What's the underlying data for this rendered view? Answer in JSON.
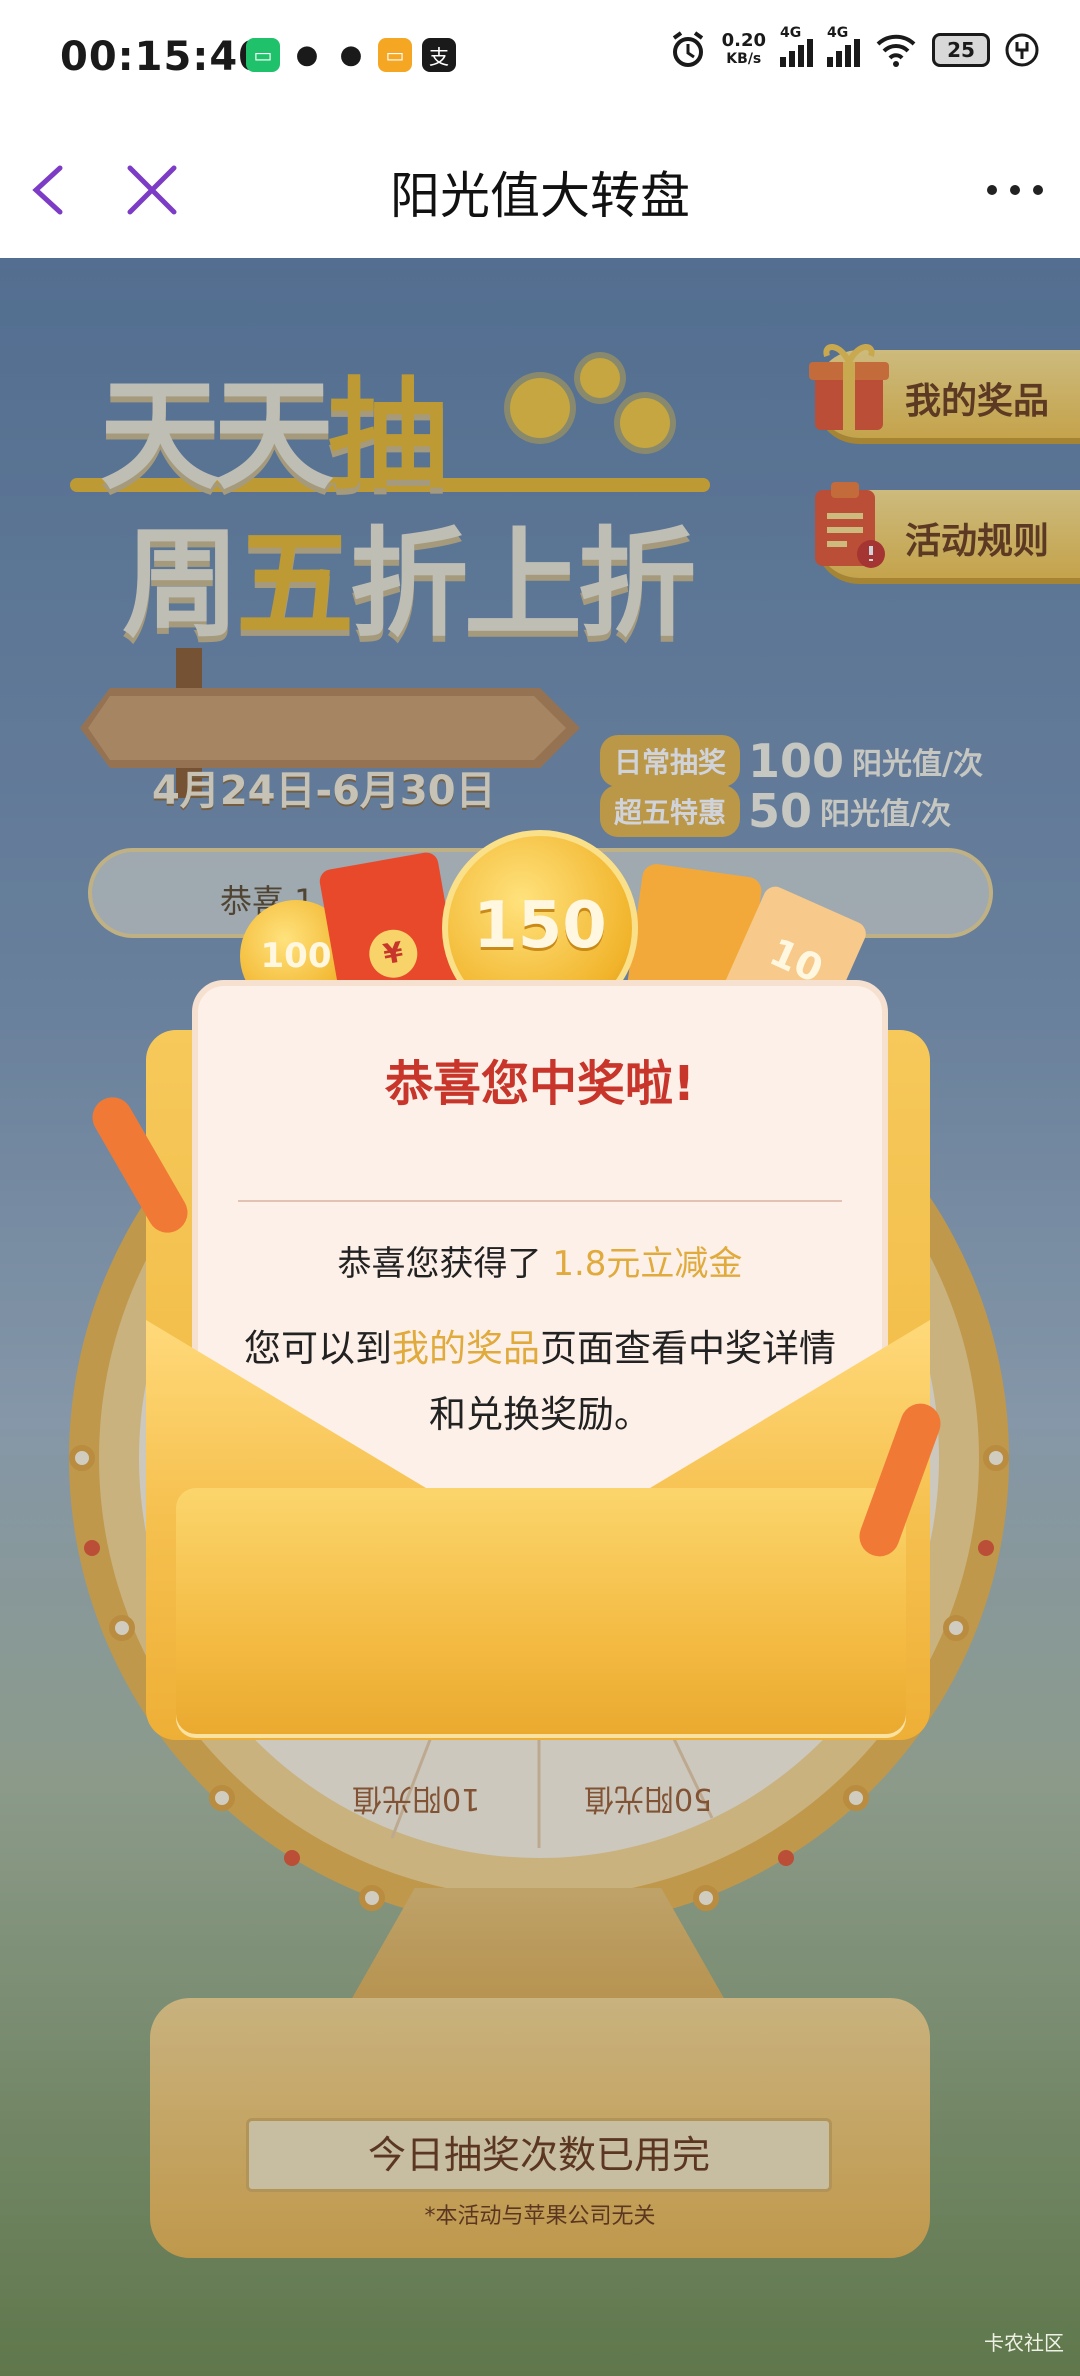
{
  "status_bar": {
    "time": "00:15:40",
    "net_speed_value": "0.20",
    "net_speed_unit": "KB/s",
    "sim1": "4G",
    "sim2": "4G",
    "battery": "25"
  },
  "nav": {
    "title": "阳光值大转盘"
  },
  "hero": {
    "line1_prefix": "天天",
    "line1_accent": "抽",
    "line2_part1": "周",
    "line2_accent": "五",
    "line2_part2": "折上折"
  },
  "side_buttons": {
    "my_prizes": "我的奖品",
    "rules": "活动规则"
  },
  "event": {
    "date_range": "4月24日-6月30日",
    "daily_tag": "日常抽奖",
    "daily_value": "100",
    "daily_unit": "阳光值/次",
    "friday_tag": "超五特惠",
    "friday_value": "50",
    "friday_unit": "阳光值/次",
    "marquee_text": "恭喜 1"
  },
  "prizes": {
    "coin_main": "150",
    "coin_small": "100",
    "yuan": "¥",
    "ticket": "10"
  },
  "wheel": {
    "segment_1": "10阳光值",
    "segment_2": "50阳光值"
  },
  "modal": {
    "title": "恭喜您中奖啦!",
    "won_prefix": "恭喜您获得了 ",
    "won_prize": "1.8元立减金",
    "detail_prefix": "您可以到",
    "detail_link": "我的奖品",
    "detail_suffix": "页面查看中奖详情和兑换奖励。"
  },
  "footer": {
    "status_button": "今日抽奖次数已用完",
    "disclaimer": "*本活动与苹果公司无关",
    "watermark": "卡农社区"
  },
  "colors": {
    "accent_red": "#c8352a",
    "accent_gold": "#e0aa3c",
    "envelope": "#f6c150"
  }
}
